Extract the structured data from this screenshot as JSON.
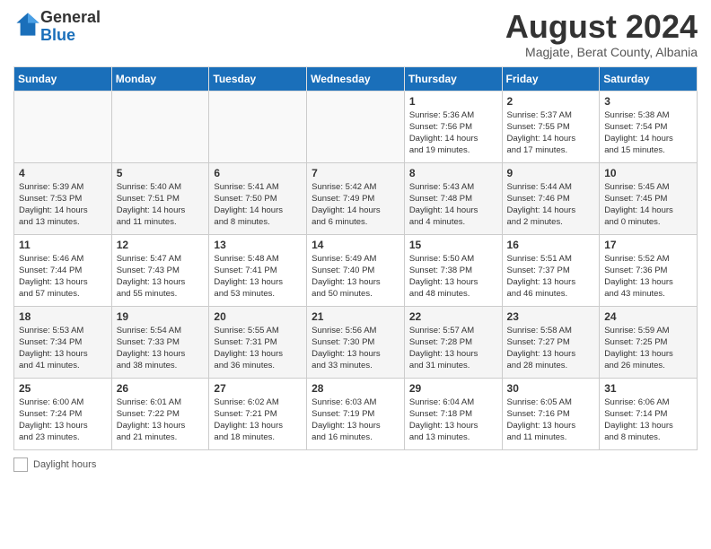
{
  "header": {
    "logo_line1": "General",
    "logo_line2": "Blue",
    "month_title": "August 2024",
    "subtitle": "Magjate, Berat County, Albania"
  },
  "days_of_week": [
    "Sunday",
    "Monday",
    "Tuesday",
    "Wednesday",
    "Thursday",
    "Friday",
    "Saturday"
  ],
  "weeks": [
    [
      {
        "day": "",
        "info": ""
      },
      {
        "day": "",
        "info": ""
      },
      {
        "day": "",
        "info": ""
      },
      {
        "day": "",
        "info": ""
      },
      {
        "day": "1",
        "info": "Sunrise: 5:36 AM\nSunset: 7:56 PM\nDaylight: 14 hours\nand 19 minutes."
      },
      {
        "day": "2",
        "info": "Sunrise: 5:37 AM\nSunset: 7:55 PM\nDaylight: 14 hours\nand 17 minutes."
      },
      {
        "day": "3",
        "info": "Sunrise: 5:38 AM\nSunset: 7:54 PM\nDaylight: 14 hours\nand 15 minutes."
      }
    ],
    [
      {
        "day": "4",
        "info": "Sunrise: 5:39 AM\nSunset: 7:53 PM\nDaylight: 14 hours\nand 13 minutes."
      },
      {
        "day": "5",
        "info": "Sunrise: 5:40 AM\nSunset: 7:51 PM\nDaylight: 14 hours\nand 11 minutes."
      },
      {
        "day": "6",
        "info": "Sunrise: 5:41 AM\nSunset: 7:50 PM\nDaylight: 14 hours\nand 8 minutes."
      },
      {
        "day": "7",
        "info": "Sunrise: 5:42 AM\nSunset: 7:49 PM\nDaylight: 14 hours\nand 6 minutes."
      },
      {
        "day": "8",
        "info": "Sunrise: 5:43 AM\nSunset: 7:48 PM\nDaylight: 14 hours\nand 4 minutes."
      },
      {
        "day": "9",
        "info": "Sunrise: 5:44 AM\nSunset: 7:46 PM\nDaylight: 14 hours\nand 2 minutes."
      },
      {
        "day": "10",
        "info": "Sunrise: 5:45 AM\nSunset: 7:45 PM\nDaylight: 14 hours\nand 0 minutes."
      }
    ],
    [
      {
        "day": "11",
        "info": "Sunrise: 5:46 AM\nSunset: 7:44 PM\nDaylight: 13 hours\nand 57 minutes."
      },
      {
        "day": "12",
        "info": "Sunrise: 5:47 AM\nSunset: 7:43 PM\nDaylight: 13 hours\nand 55 minutes."
      },
      {
        "day": "13",
        "info": "Sunrise: 5:48 AM\nSunset: 7:41 PM\nDaylight: 13 hours\nand 53 minutes."
      },
      {
        "day": "14",
        "info": "Sunrise: 5:49 AM\nSunset: 7:40 PM\nDaylight: 13 hours\nand 50 minutes."
      },
      {
        "day": "15",
        "info": "Sunrise: 5:50 AM\nSunset: 7:38 PM\nDaylight: 13 hours\nand 48 minutes."
      },
      {
        "day": "16",
        "info": "Sunrise: 5:51 AM\nSunset: 7:37 PM\nDaylight: 13 hours\nand 46 minutes."
      },
      {
        "day": "17",
        "info": "Sunrise: 5:52 AM\nSunset: 7:36 PM\nDaylight: 13 hours\nand 43 minutes."
      }
    ],
    [
      {
        "day": "18",
        "info": "Sunrise: 5:53 AM\nSunset: 7:34 PM\nDaylight: 13 hours\nand 41 minutes."
      },
      {
        "day": "19",
        "info": "Sunrise: 5:54 AM\nSunset: 7:33 PM\nDaylight: 13 hours\nand 38 minutes."
      },
      {
        "day": "20",
        "info": "Sunrise: 5:55 AM\nSunset: 7:31 PM\nDaylight: 13 hours\nand 36 minutes."
      },
      {
        "day": "21",
        "info": "Sunrise: 5:56 AM\nSunset: 7:30 PM\nDaylight: 13 hours\nand 33 minutes."
      },
      {
        "day": "22",
        "info": "Sunrise: 5:57 AM\nSunset: 7:28 PM\nDaylight: 13 hours\nand 31 minutes."
      },
      {
        "day": "23",
        "info": "Sunrise: 5:58 AM\nSunset: 7:27 PM\nDaylight: 13 hours\nand 28 minutes."
      },
      {
        "day": "24",
        "info": "Sunrise: 5:59 AM\nSunset: 7:25 PM\nDaylight: 13 hours\nand 26 minutes."
      }
    ],
    [
      {
        "day": "25",
        "info": "Sunrise: 6:00 AM\nSunset: 7:24 PM\nDaylight: 13 hours\nand 23 minutes."
      },
      {
        "day": "26",
        "info": "Sunrise: 6:01 AM\nSunset: 7:22 PM\nDaylight: 13 hours\nand 21 minutes."
      },
      {
        "day": "27",
        "info": "Sunrise: 6:02 AM\nSunset: 7:21 PM\nDaylight: 13 hours\nand 18 minutes."
      },
      {
        "day": "28",
        "info": "Sunrise: 6:03 AM\nSunset: 7:19 PM\nDaylight: 13 hours\nand 16 minutes."
      },
      {
        "day": "29",
        "info": "Sunrise: 6:04 AM\nSunset: 7:18 PM\nDaylight: 13 hours\nand 13 minutes."
      },
      {
        "day": "30",
        "info": "Sunrise: 6:05 AM\nSunset: 7:16 PM\nDaylight: 13 hours\nand 11 minutes."
      },
      {
        "day": "31",
        "info": "Sunrise: 6:06 AM\nSunset: 7:14 PM\nDaylight: 13 hours\nand 8 minutes."
      }
    ]
  ],
  "footer": {
    "label": "Daylight hours"
  }
}
